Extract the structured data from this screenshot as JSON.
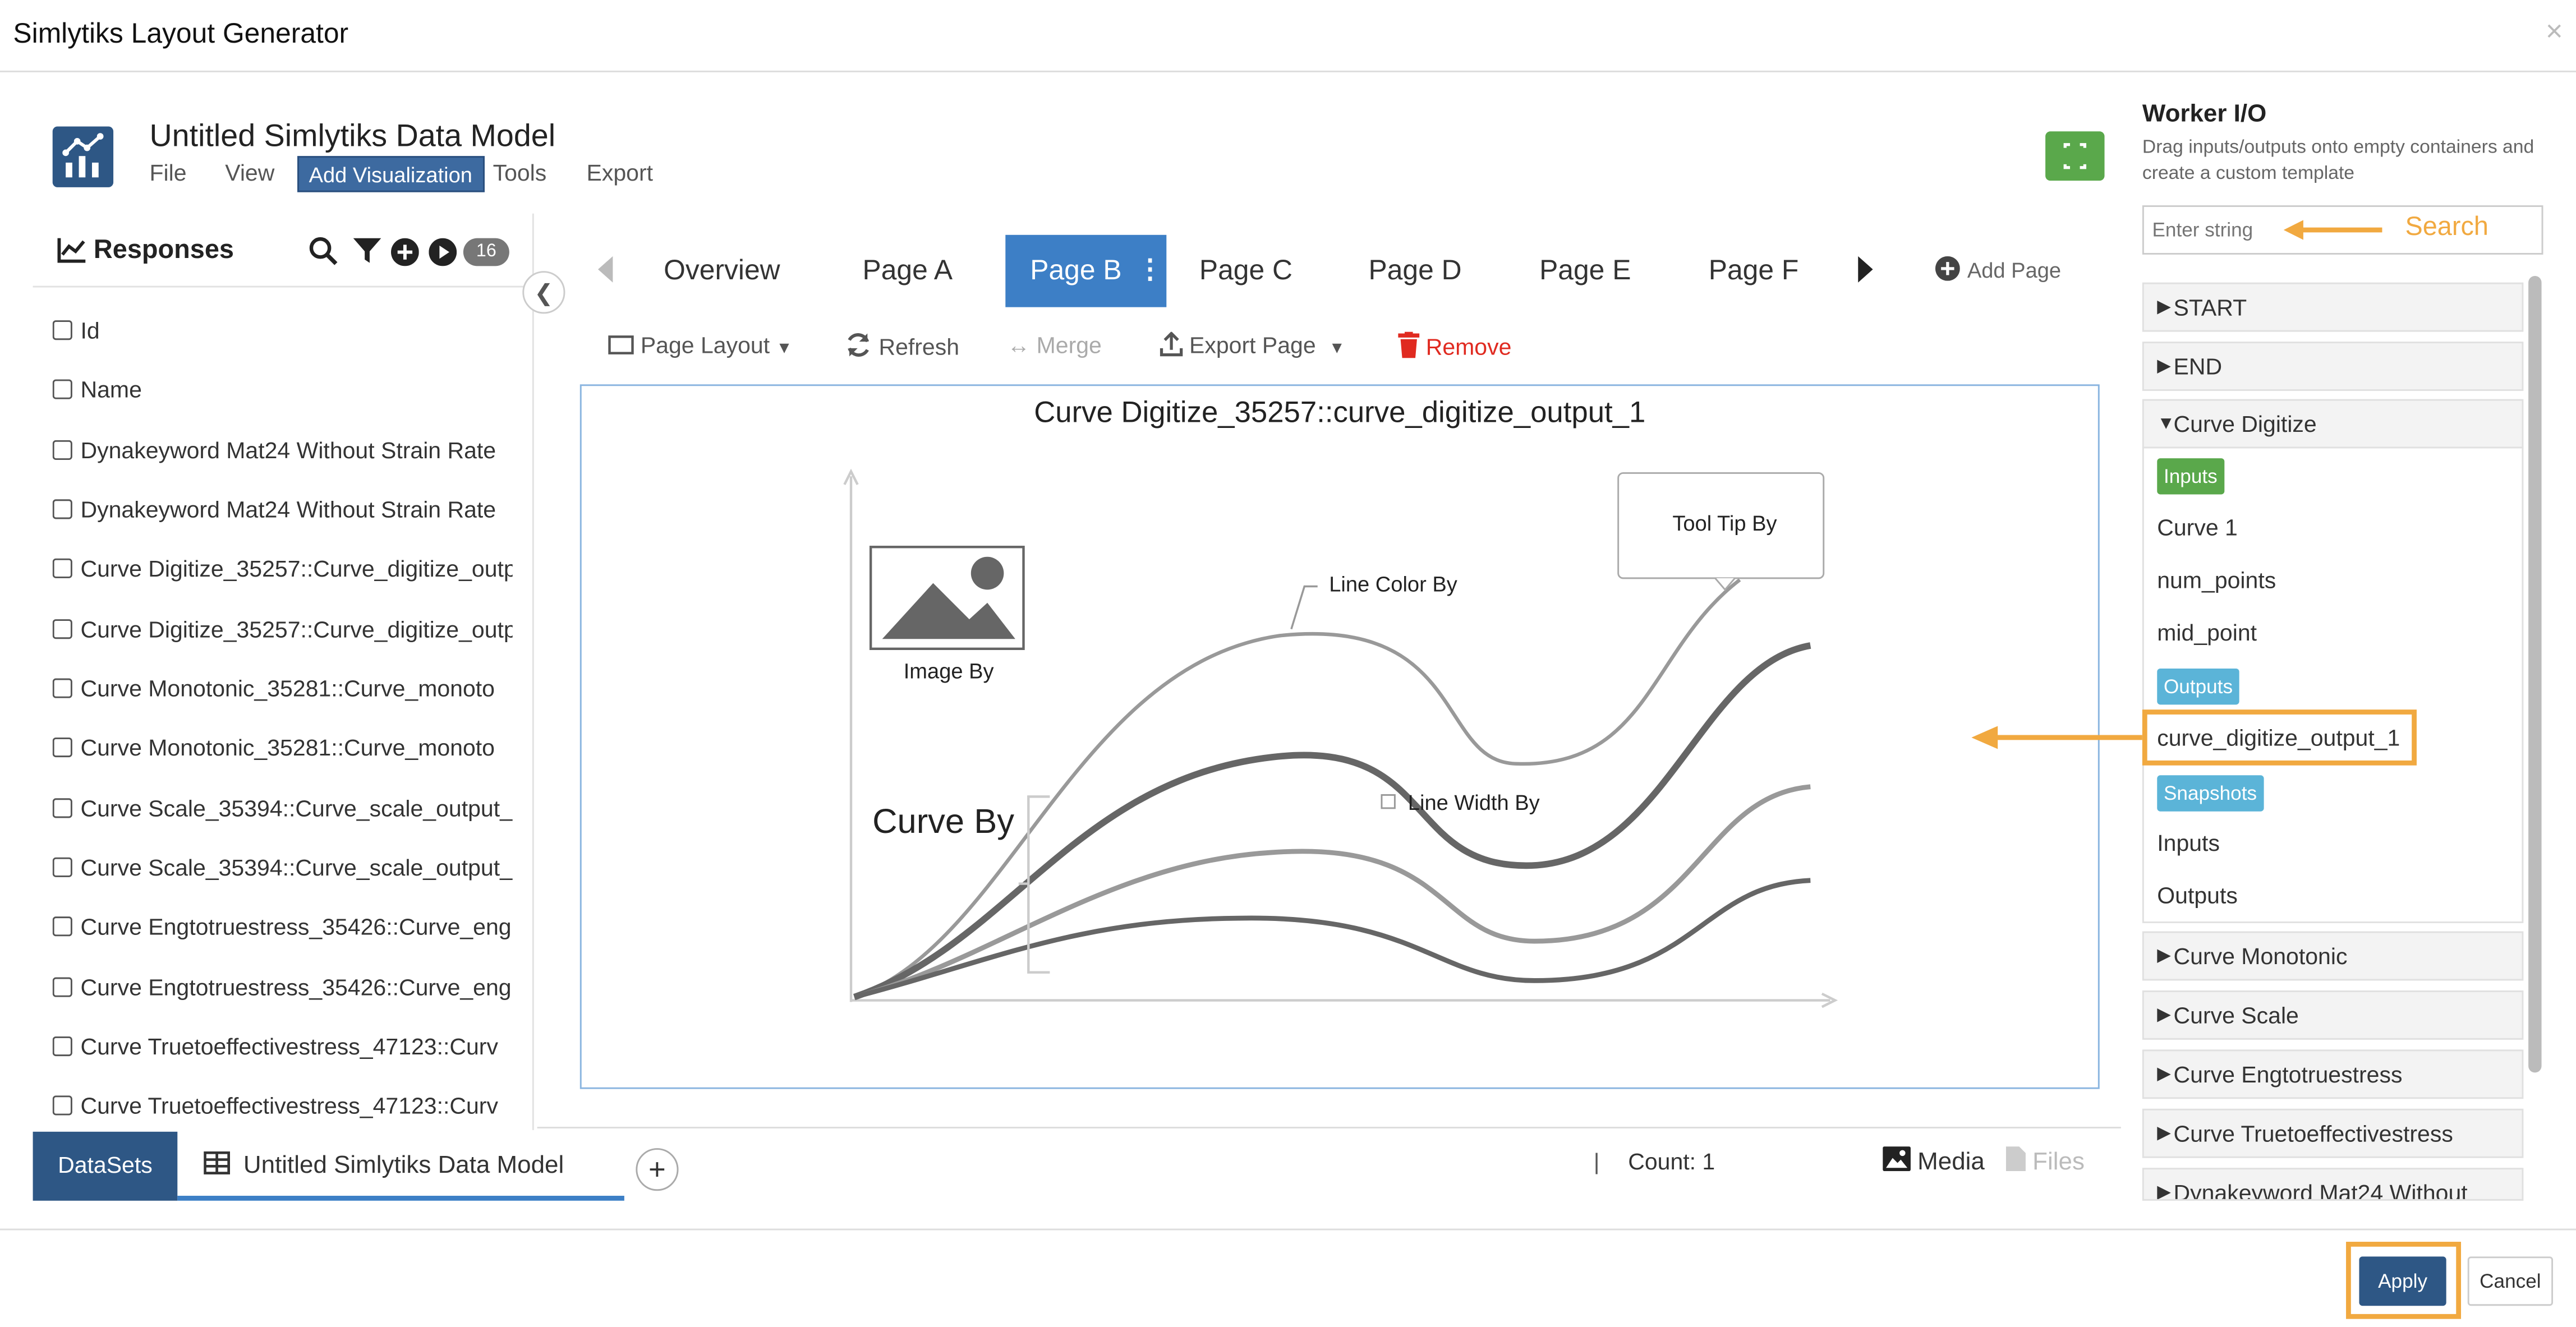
{
  "window": {
    "title": "Simlytiks Layout Generator",
    "close": "×"
  },
  "header": {
    "model_title": "Untitled Simlytiks Data Model",
    "menu": [
      "File",
      "View",
      "Add Visualization",
      "Tools",
      "Export"
    ]
  },
  "responses": {
    "title": "Responses",
    "count": "16",
    "items": [
      "Id",
      "Name",
      "Dynakeyword Mat24 Without Strain Rate",
      "Dynakeyword Mat24 Without Strain Rate",
      "Curve Digitize_35257::Curve_digitize_outp",
      "Curve Digitize_35257::Curve_digitize_outp",
      "Curve Monotonic_35281::Curve_monoto",
      "Curve Monotonic_35281::Curve_monoto",
      "Curve Scale_35394::Curve_scale_output_",
      "Curve Scale_35394::Curve_scale_output_",
      "Curve Engtotruestress_35426::Curve_eng",
      "Curve Engtotruestress_35426::Curve_eng",
      "Curve Truetoeffectivestress_47123::Curv",
      "Curve Truetoeffectivestress_47123::Curv"
    ]
  },
  "tabs": [
    "Overview",
    "Page A",
    "Page B",
    "Page C",
    "Page D",
    "Page E",
    "Page F"
  ],
  "add_page": "Add Page",
  "toolbar": {
    "page_layout": "Page Layout",
    "refresh": "Refresh",
    "merge": "Merge",
    "export_page": "Export Page",
    "remove": "Remove"
  },
  "visual": {
    "title": "Curve Digitize_35257::curve_digitize_output_1",
    "image_by": "Image By",
    "line_color_by": "Line Color By",
    "tool_tip_by": "Tool Tip By",
    "line_width_by": "Line Width By",
    "curve_by": "Curve By"
  },
  "bottom": {
    "datasets": "DataSets",
    "model_tab": "Untitled Simlytiks Data Model",
    "separator": "|",
    "count": "Count: 1",
    "media": "Media",
    "files": "Files"
  },
  "worker_io": {
    "title": "Worker I/O",
    "description": "Drag inputs/outputs onto empty containers and create a custom template",
    "search_placeholder": "Enter string",
    "search_annotation": "Search",
    "sections": [
      "START",
      "END",
      "Curve Digitize",
      "Curve Monotonic",
      "Curve Scale",
      "Curve Engtotruestress",
      "Curve Truetoeffectivestress",
      "Dynakeyword Mat24 Without"
    ],
    "inputs_badge": "Inputs",
    "inputs": [
      "Curve 1",
      "num_points",
      "mid_point"
    ],
    "outputs_badge": "Outputs",
    "outputs": [
      "curve_digitize_output_1"
    ],
    "snapshots_badge": "Snapshots",
    "snapshots": [
      "Inputs",
      "Outputs"
    ]
  },
  "footer": {
    "apply": "Apply",
    "cancel": "Cancel"
  },
  "colors": {
    "primary": "#2e5785",
    "tab_active": "#3d7fc6",
    "accent_orange": "#f1a940",
    "green": "#5aa84b",
    "inputs_badge": "#5aa84b",
    "outputs_badge": "#5bb4d8",
    "remove_red": "#e02a20"
  }
}
